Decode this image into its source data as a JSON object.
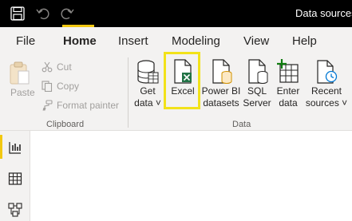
{
  "window": {
    "title": "Data sources"
  },
  "quick_access": {
    "icons": [
      "save-icon",
      "undo-icon",
      "redo-icon"
    ]
  },
  "menu": {
    "tabs": [
      {
        "label": "File",
        "active": false
      },
      {
        "label": "Home",
        "active": true
      },
      {
        "label": "Insert",
        "active": false
      },
      {
        "label": "Modeling",
        "active": false
      },
      {
        "label": "View",
        "active": false
      },
      {
        "label": "Help",
        "active": false
      }
    ]
  },
  "ribbon": {
    "clipboard": {
      "paste": "Paste",
      "cut": "Cut",
      "copy": "Copy",
      "format_painter": "Format painter",
      "group_label": "Clipboard"
    },
    "data": {
      "get_data": {
        "line1": "Get",
        "line2": "data ˅"
      },
      "excel": {
        "line1": "Excel"
      },
      "powerbi": {
        "line1": "Power BI",
        "line2": "datasets"
      },
      "sql": {
        "line1": "SQL",
        "line2": "Server"
      },
      "enter": {
        "line1": "Enter",
        "line2": "data"
      },
      "recent": {
        "line1": "Recent",
        "line2": "sources ˅"
      },
      "group_label": "Data"
    }
  },
  "colors": {
    "accent": "#f2c811",
    "highlight": "#f2e21a",
    "excel_green": "#217346",
    "titlebar": "#000000",
    "ribbon_bg": "#f3f2f1"
  },
  "leftnav": {
    "icons": [
      "report-view-icon",
      "data-view-icon",
      "model-view-icon"
    ]
  }
}
